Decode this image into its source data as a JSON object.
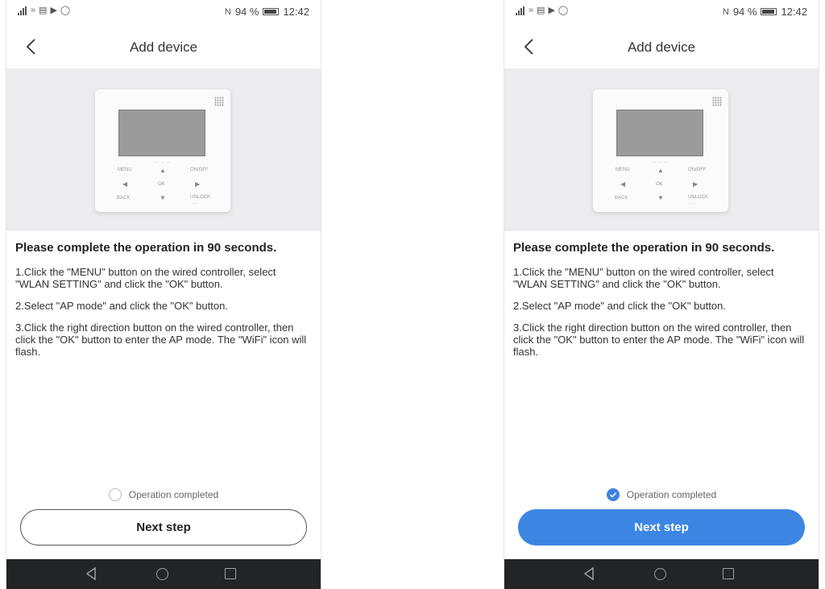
{
  "status_bar": {
    "battery_percent": "94 %",
    "time": "12:42",
    "nfc_glyph": "N",
    "left_icons": [
      "signal-icon",
      "wifi-icon",
      "data-icon",
      "video-icon",
      "whatsapp-icon"
    ]
  },
  "header": {
    "title": "Add device",
    "back_icon": "chevron-left-icon"
  },
  "controller": {
    "labels": [
      "MENU",
      "ON/OFF",
      "OK",
      "BACK",
      "UNLOCK"
    ]
  },
  "instructions": {
    "headline": "Please complete the operation in 90 seconds.",
    "steps": [
      "1.Click the \"MENU\" button on the wired controller, select \"WLAN SETTING\" and click the \"OK\" button.",
      "2.Select \"AP mode\" and click the \"OK\" button.",
      "3.Click the right direction button on the wired controller, then click the \"OK\" button to enter the AP mode. The \"WiFi\" icon will flash."
    ]
  },
  "footer": {
    "confirm_label": "Operation completed",
    "next_label": "Next step"
  },
  "screens": [
    {
      "id": "before",
      "operation_completed": false,
      "next_button_style": "outline"
    },
    {
      "id": "after",
      "operation_completed": true,
      "next_button_style": "filled"
    }
  ],
  "colors": {
    "accent": "#3d86e3",
    "image_background": "#ececee",
    "nav_bar": "#232426"
  },
  "nav_bar": {
    "icons": [
      "nav-back-icon",
      "nav-home-icon",
      "nav-recent-icon"
    ]
  }
}
